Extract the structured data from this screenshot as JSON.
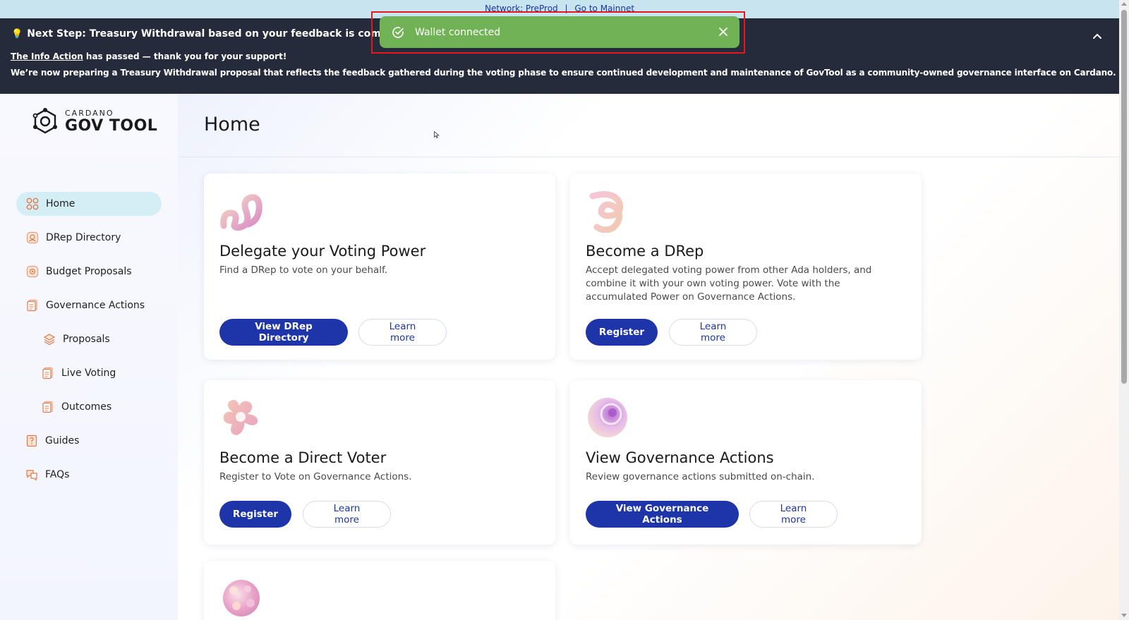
{
  "network_bar": {
    "network_label": "Network: PreProd",
    "separator": "|",
    "mainnet_link": "Go to Mainnet"
  },
  "banner": {
    "title": "Next Step: Treasury Withdrawal based on your feedback is coming soon",
    "line1_link": "The Info Action",
    "line1_rest": " has passed — thank you for your support!",
    "line2": "We’re now preparing a Treasury Withdrawal proposal that reflects the feedback gathered during the voting phase to ensure continued development and maintenance of GovTool as a community-owned governance interface on Cardano."
  },
  "toast": {
    "message": "Wallet connected",
    "color": "#72b257"
  },
  "logo": {
    "small": "CARDANO",
    "big": "GOV TOOL"
  },
  "sidebar": {
    "items": [
      {
        "label": "Home",
        "icon": "home-grid-icon",
        "active": true
      },
      {
        "label": "DRep Directory",
        "icon": "drep-directory-icon"
      },
      {
        "label": "Budget Proposals",
        "icon": "budget-proposals-icon"
      },
      {
        "label": "Governance Actions",
        "icon": "governance-actions-icon"
      },
      {
        "label": "Proposals",
        "icon": "proposals-icon",
        "sub": true
      },
      {
        "label": "Live Voting",
        "icon": "live-voting-icon",
        "sub": true
      },
      {
        "label": "Outcomes",
        "icon": "outcomes-icon",
        "sub": true
      },
      {
        "label": "Guides",
        "icon": "guides-icon"
      },
      {
        "label": "FAQs",
        "icon": "faqs-icon"
      }
    ]
  },
  "page": {
    "title": "Home"
  },
  "cards": [
    {
      "title": "Delegate your Voting Power",
      "description": "Find a DRep to vote on your behalf.",
      "primary": "View DRep Directory",
      "secondary": "Learn more"
    },
    {
      "title": "Become a DRep",
      "description": "Accept delegated voting power from other Ada holders, and combine it with your own voting power. Vote with the accumulated Power on Governance Actions.",
      "primary": "Register",
      "secondary": "Learn more"
    },
    {
      "title": "Become a Direct Voter",
      "description": "Register to Vote on Governance Actions.",
      "primary": "Register",
      "secondary": "Learn more"
    },
    {
      "title": "View Governance Actions",
      "description": "Review governance actions submitted on-chain.",
      "primary": "View Governance Actions",
      "secondary": "Learn more"
    }
  ],
  "colors": {
    "primary_button": "#1d35a8",
    "banner_bg": "#252b3a",
    "network_bar_bg": "#c7e4ef",
    "active_nav_bg": "#d4eef6",
    "toast_outline": "#e3191f"
  }
}
